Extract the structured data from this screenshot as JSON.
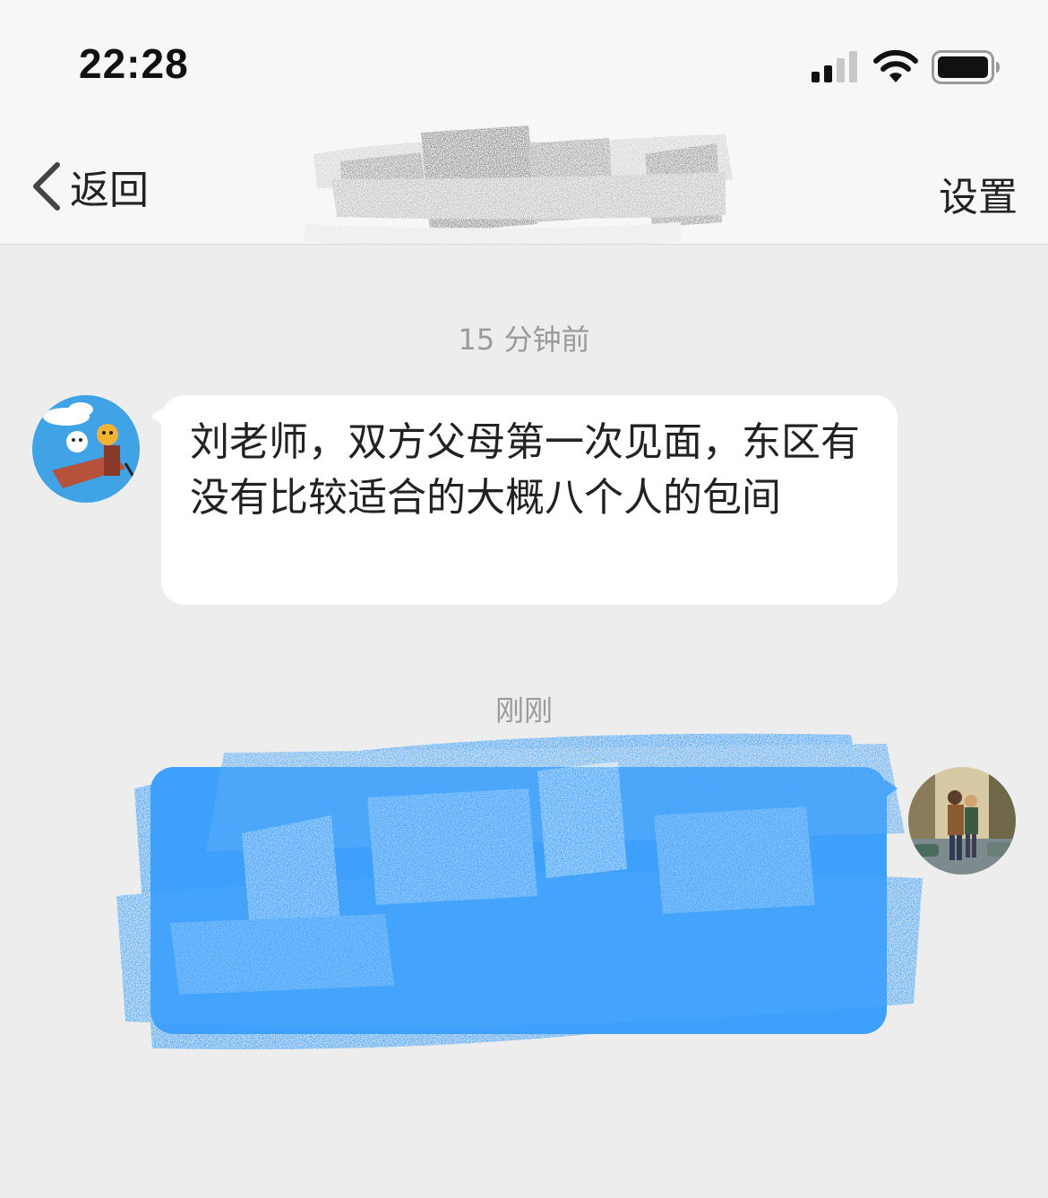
{
  "status_bar": {
    "time": "22:28",
    "icons": [
      "cellular-signal-icon",
      "wifi-icon",
      "battery-icon"
    ]
  },
  "nav": {
    "back_label": "返回",
    "back_icon": "chevron-left-icon",
    "settings_label": "设置"
  },
  "chat": {
    "messages": [
      {
        "timestamp": "15 分钟前",
        "direction": "received",
        "text": "刘老师，双方父母第一次见面，东区有没有比较适合的大概八个人的包间"
      },
      {
        "timestamp": "刚刚",
        "direction": "sent",
        "text": ""
      }
    ]
  },
  "colors": {
    "background": "#ededed",
    "bar_background": "#f7f7f7",
    "received_bubble": "#ffffff",
    "sent_bubble": "#3ea0fb",
    "timestamp_text": "#9a9a9a"
  }
}
